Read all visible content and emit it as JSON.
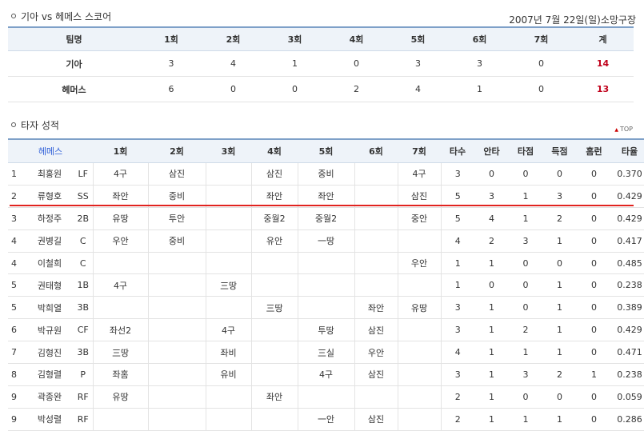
{
  "score_section": {
    "title": "기아 vs 헤메스 스코어",
    "date": "2007년 7월 22일(일)소망구장",
    "headers": [
      "팀명",
      "1회",
      "2회",
      "3회",
      "4회",
      "5회",
      "6회",
      "7회",
      "계"
    ],
    "rows": [
      {
        "team": "기아",
        "innings": [
          "3",
          "4",
          "1",
          "0",
          "3",
          "3",
          "0"
        ],
        "total": "14"
      },
      {
        "team": "헤머스",
        "innings": [
          "6",
          "0",
          "0",
          "2",
          "4",
          "1",
          "0"
        ],
        "total": "13"
      }
    ]
  },
  "batter_section": {
    "title": "타자 성적",
    "top_link": "TOP",
    "headers": [
      "헤메스",
      "1회",
      "2회",
      "3회",
      "4회",
      "5회",
      "6회",
      "7회",
      "타수",
      "안타",
      "타점",
      "득점",
      "홈런",
      "타율"
    ],
    "rows": [
      {
        "no": "1",
        "name": "최홍원",
        "pos": "LF",
        "innings": [
          "4구",
          "삼진",
          "",
          "삼진",
          "중비",
          "",
          "4구"
        ],
        "stats": [
          "3",
          "0",
          "0",
          "0",
          "0",
          "0.370"
        ]
      },
      {
        "no": "2",
        "name": "류형호",
        "pos": "SS",
        "innings": [
          "좌안",
          "중비",
          "",
          "좌안",
          "좌안",
          "",
          "삼진"
        ],
        "stats": [
          "5",
          "3",
          "1",
          "3",
          "0",
          "0.429"
        ]
      },
      {
        "no": "3",
        "name": "하정주",
        "pos": "2B",
        "innings": [
          "유땅",
          "투안",
          "",
          "중월2",
          "중월2",
          "",
          "중안"
        ],
        "stats": [
          "5",
          "4",
          "1",
          "2",
          "0",
          "0.429"
        ]
      },
      {
        "no": "4",
        "name": "권병길",
        "pos": "C",
        "innings": [
          "우안",
          "중비",
          "",
          "유안",
          "一땅",
          "",
          ""
        ],
        "stats": [
          "4",
          "2",
          "3",
          "1",
          "0",
          "0.417"
        ]
      },
      {
        "no": "4",
        "name": "이철희",
        "pos": "C",
        "innings": [
          "",
          "",
          "",
          "",
          "",
          "",
          "우안"
        ],
        "stats": [
          "1",
          "1",
          "0",
          "0",
          "0",
          "0.485"
        ]
      },
      {
        "no": "5",
        "name": "권태형",
        "pos": "1B",
        "innings": [
          "4구",
          "",
          "三땅",
          "",
          "",
          "",
          ""
        ],
        "stats": [
          "1",
          "0",
          "0",
          "1",
          "0",
          "0.238"
        ]
      },
      {
        "no": "5",
        "name": "박희열",
        "pos": "3B",
        "innings": [
          "",
          "",
          "",
          "三땅",
          "",
          "좌안",
          "유땅"
        ],
        "stats": [
          "3",
          "1",
          "0",
          "1",
          "0",
          "0.389"
        ]
      },
      {
        "no": "6",
        "name": "박규원",
        "pos": "CF",
        "innings": [
          "좌선2",
          "",
          "4구",
          "",
          "투땅",
          "삼진",
          ""
        ],
        "stats": [
          "3",
          "1",
          "2",
          "1",
          "0",
          "0.429"
        ]
      },
      {
        "no": "7",
        "name": "김형진",
        "pos": "3B",
        "innings": [
          "三땅",
          "",
          "좌비",
          "",
          "三실",
          "우안",
          ""
        ],
        "stats": [
          "4",
          "1",
          "1",
          "1",
          "0",
          "0.471"
        ]
      },
      {
        "no": "8",
        "name": "김형렬",
        "pos": "P",
        "innings": [
          "좌홈",
          "",
          "유비",
          "",
          "4구",
          "삼진",
          ""
        ],
        "stats": [
          "3",
          "1",
          "3",
          "2",
          "1",
          "0.238"
        ]
      },
      {
        "no": "9",
        "name": "곽종완",
        "pos": "RF",
        "innings": [
          "유땅",
          "",
          "",
          "좌안",
          "",
          "",
          ""
        ],
        "stats": [
          "2",
          "1",
          "0",
          "0",
          "0",
          "0.059"
        ]
      },
      {
        "no": "9",
        "name": "박성렬",
        "pos": "RF",
        "innings": [
          "",
          "",
          "",
          "",
          "一안",
          "삼진",
          ""
        ],
        "stats": [
          "2",
          "1",
          "1",
          "1",
          "0",
          "0.286"
        ]
      }
    ]
  },
  "colors": {
    "accent": "#7ea0c8",
    "header_bg": "#eef3f9",
    "total_red": "#c0001a",
    "highlight_line": "#e1231f",
    "team_link": "#2a5bd7"
  }
}
